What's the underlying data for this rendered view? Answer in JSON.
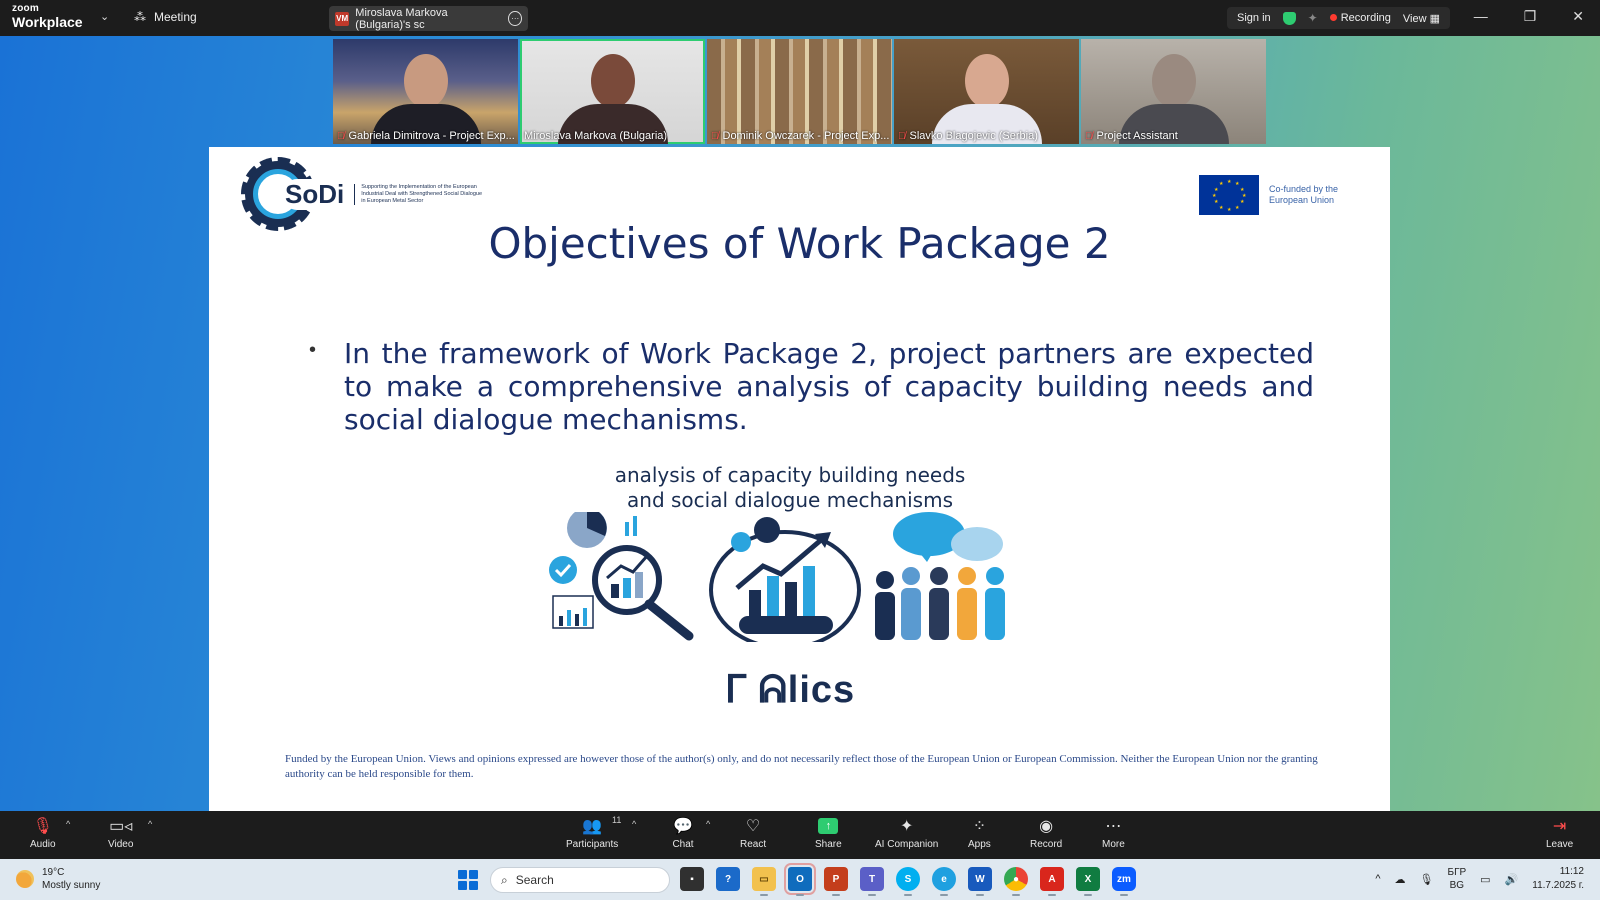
{
  "app": {
    "brand_small": "zoom",
    "brand_big": "Workplace"
  },
  "topbar": {
    "meeting_label": "Meeting",
    "share_badge": "VM",
    "share_title": "Miroslava Markova (Bulgaria)'s sc",
    "sign_in": "Sign in",
    "recording": "Recording",
    "view": "View"
  },
  "participants": [
    {
      "name": "Gabriela Dimitrova - Project Exp..."
    },
    {
      "name": "Miroslava Markova (Bulgaria)"
    },
    {
      "name": "Dominik Owczarek - Project Exp..."
    },
    {
      "name": "Slavko Blagojevic (Serbia)"
    },
    {
      "name": "Project Assistant"
    }
  ],
  "slide": {
    "logo_text": "SoDi",
    "logo_tagline": "Supporting the Implementation of the European Industrial Deal with Strengthened Social Dialogue in European Metal Sector",
    "eu_text_line1": "Co-funded by the",
    "eu_text_line2": "European Union",
    "title": "Objectives of Work Package 2",
    "bullet": "In the framework of Work Package 2, project partners are expected to make a comprehensive analysis of capacity building needs and social dialogue mechanisms.",
    "caption_line1": "analysis of capacity building needs",
    "caption_line2": "and social dialogue mechanisms",
    "partial_text": "ᒥ ᕱlics",
    "disclaimer": "Funded by the European Union. Views and opinions expressed are however those of the author(s) only, and do not necessarily reflect those of the European Union or European Commission. Neither the European Union nor the granting authority can be held responsible for them."
  },
  "toolbar": {
    "audio": "Audio",
    "video": "Video",
    "participants": "Participants",
    "participant_count": "11",
    "chat": "Chat",
    "react": "React",
    "share": "Share",
    "ai_companion": "AI Companion",
    "apps": "Apps",
    "record": "Record",
    "more": "More",
    "leave": "Leave"
  },
  "taskbar": {
    "temp": "19°C",
    "weather": "Mostly sunny",
    "search_placeholder": "Search",
    "lang_line1": "БГР",
    "lang_line2": "BG",
    "time": "11:12",
    "date": "11.7.2025 г."
  },
  "colors": {
    "accent_green": "#2ecc71",
    "slide_title": "#1a2e6a",
    "recording_dot": "#ff3b30"
  }
}
